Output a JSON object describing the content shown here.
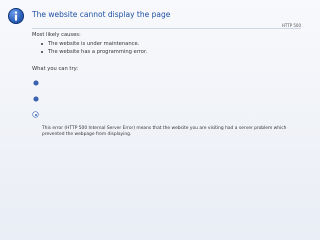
{
  "header": {
    "icon": "info-icon",
    "title": "The website cannot display the page",
    "http_code": "HTTP 500"
  },
  "causes": {
    "heading": "Most likely causes:",
    "items": [
      "The website is under maintenance.",
      "The website has a programming error."
    ]
  },
  "actions": {
    "heading": "What you can try:",
    "options": [
      {
        "icon": "bullet-icon"
      },
      {
        "icon": "bullet-icon"
      },
      {
        "icon": "radio-selected-icon"
      }
    ]
  },
  "error_description": "This error (HTTP 500 Internal Server Error) means that the website you are visiting had a server problem which prevented the webpage from displaying.",
  "colors": {
    "title_blue": "#1f4fa3",
    "bullet_blue": "#3a64b6",
    "background_top": "#f8f9fc",
    "background_bottom": "#e9edf5"
  }
}
